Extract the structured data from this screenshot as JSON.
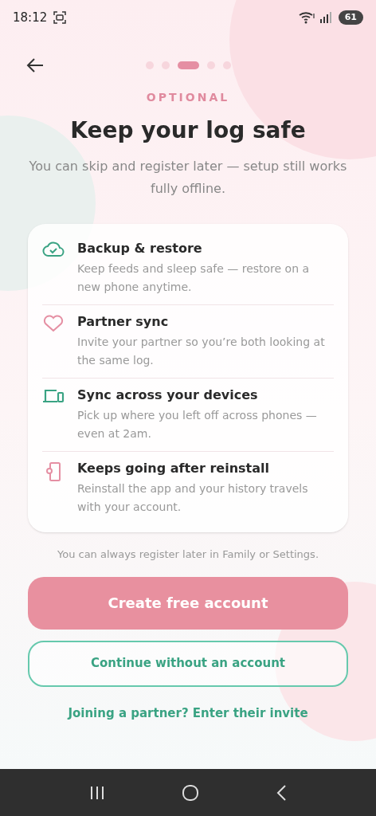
{
  "status_bar": {
    "time": "18:12",
    "battery": "61"
  },
  "progress_dots": [
    {
      "selected": false
    },
    {
      "selected": false
    },
    {
      "selected": true
    },
    {
      "selected": false
    },
    {
      "selected": false
    }
  ],
  "eyebrow": "OPTIONAL",
  "title": "Keep your log safe",
  "subtitle": "You can skip and register later — setup still works fully offline.",
  "features": [
    {
      "kind": "cloud",
      "title": "Backup & restore",
      "description": "Keep feeds and sleep safe — restore on a new phone anytime."
    },
    {
      "kind": "heart",
      "title": "Partner sync",
      "description": "Invite your partner so you’re both looking at the same log."
    },
    {
      "kind": "devices",
      "title": "Sync across your devices",
      "description": "Pick up where you left off across phones — even at 2am."
    },
    {
      "kind": "phone",
      "title": "Keeps going after reinstall",
      "description": "Reinstall the app and your history travels with your account."
    }
  ],
  "note": "You can always register later in Family or Settings.",
  "primary_button": "Create free account",
  "secondary_button": "Continue without an account",
  "link": "Joining a partner? Enter their invite"
}
